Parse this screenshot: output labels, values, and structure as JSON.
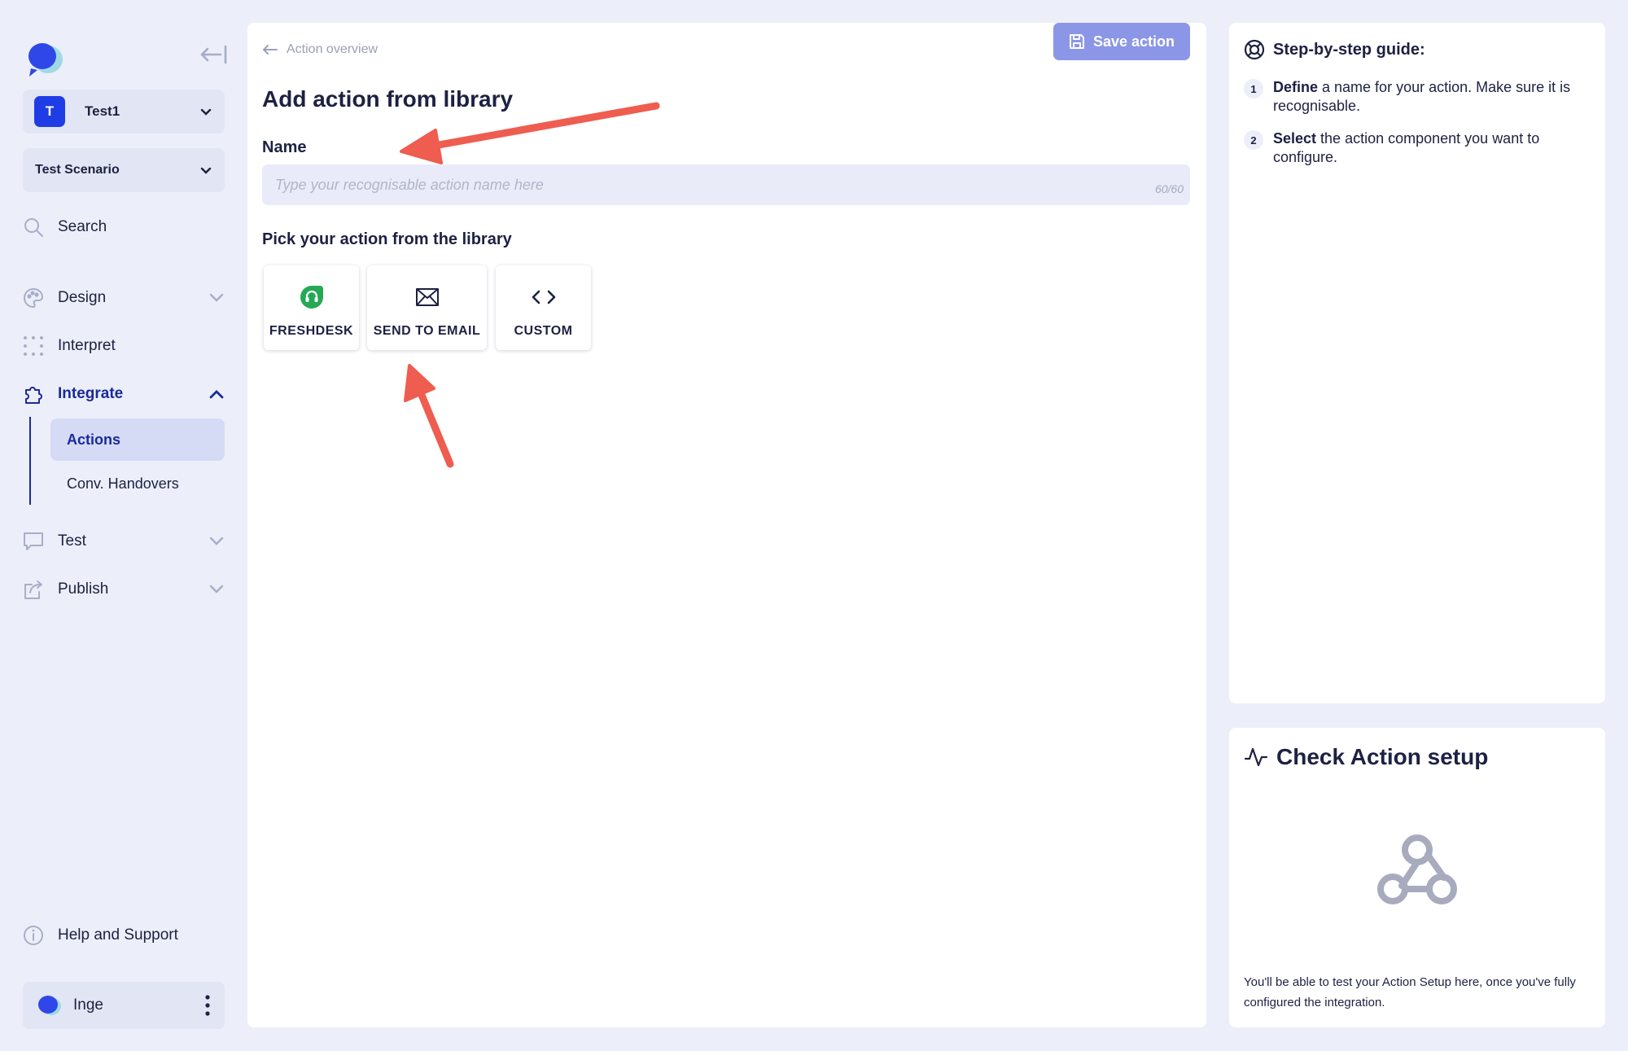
{
  "sidebar": {
    "workspace": {
      "initial": "T",
      "name": "Test1"
    },
    "scenario": "Test Scenario",
    "nav": {
      "search": "Search",
      "design": "Design",
      "interpret": "Interpret",
      "integrate": "Integrate",
      "test": "Test",
      "publish": "Publish"
    },
    "subnav": {
      "actions": "Actions",
      "handovers": "Conv. Handovers"
    },
    "help": "Help and Support",
    "user": "Inge"
  },
  "main": {
    "back_label": "Action overview",
    "save_label": "Save action",
    "title": "Add action from library",
    "name_label": "Name",
    "name_placeholder": "Type your recognisable action name here",
    "name_value": "",
    "char_count": "60/60",
    "library_label": "Pick your action from the library",
    "library": [
      {
        "label": "FRESHDESK",
        "icon": "freshdesk-icon"
      },
      {
        "label": "SEND TO EMAIL",
        "icon": "email-icon"
      },
      {
        "label": "CUSTOM",
        "icon": "code-icon"
      }
    ]
  },
  "guide": {
    "title": "Step-by-step guide:",
    "steps": [
      {
        "num": "1",
        "bold": "Define",
        "text": " a name for your action. Make sure it is recognisable."
      },
      {
        "num": "2",
        "bold": "Select",
        "text": " the action component you want to configure."
      }
    ]
  },
  "check": {
    "title": "Check Action setup",
    "note": "You'll be able to test your Action Setup here, once you've fully configured the integration."
  },
  "colors": {
    "accent": "#1b2a9a",
    "save_button": "#8c96e6",
    "annotation_arrow": "#ee5d4f",
    "freshdesk": "#25a955"
  }
}
